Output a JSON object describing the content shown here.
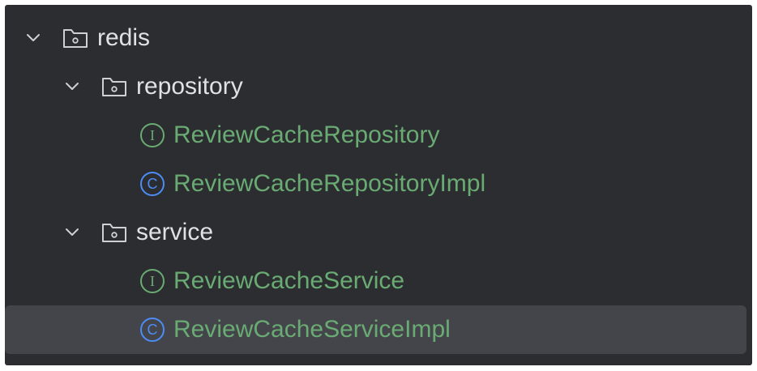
{
  "tree": {
    "items": [
      {
        "label": "redis",
        "kind": "folder",
        "expanded": true,
        "icon": "folder-icon",
        "chevron": "chevron-down-icon"
      },
      {
        "label": "repository",
        "kind": "folder",
        "expanded": true,
        "icon": "folder-icon",
        "chevron": "chevron-down-icon"
      },
      {
        "label": "ReviewCacheRepository",
        "kind": "interface",
        "icon": "interface-icon",
        "badge_letter": "I"
      },
      {
        "label": "ReviewCacheRepositoryImpl",
        "kind": "class",
        "icon": "class-icon",
        "badge_letter": "C"
      },
      {
        "label": "service",
        "kind": "folder",
        "expanded": true,
        "icon": "folder-icon",
        "chevron": "chevron-down-icon"
      },
      {
        "label": "ReviewCacheService",
        "kind": "interface",
        "icon": "interface-icon",
        "badge_letter": "I"
      },
      {
        "label": "ReviewCacheServiceImpl",
        "kind": "class",
        "icon": "class-icon",
        "badge_letter": "C",
        "selected": true
      }
    ]
  },
  "colors": {
    "panel_bg": "#2b2d30",
    "selected_bg": "#43454a",
    "folder_text": "#dfe1e5",
    "file_text": "#6aab73",
    "interface_badge": "#6aab73",
    "class_badge": "#4d8cf5",
    "icon_stroke": "#ced0d6"
  }
}
